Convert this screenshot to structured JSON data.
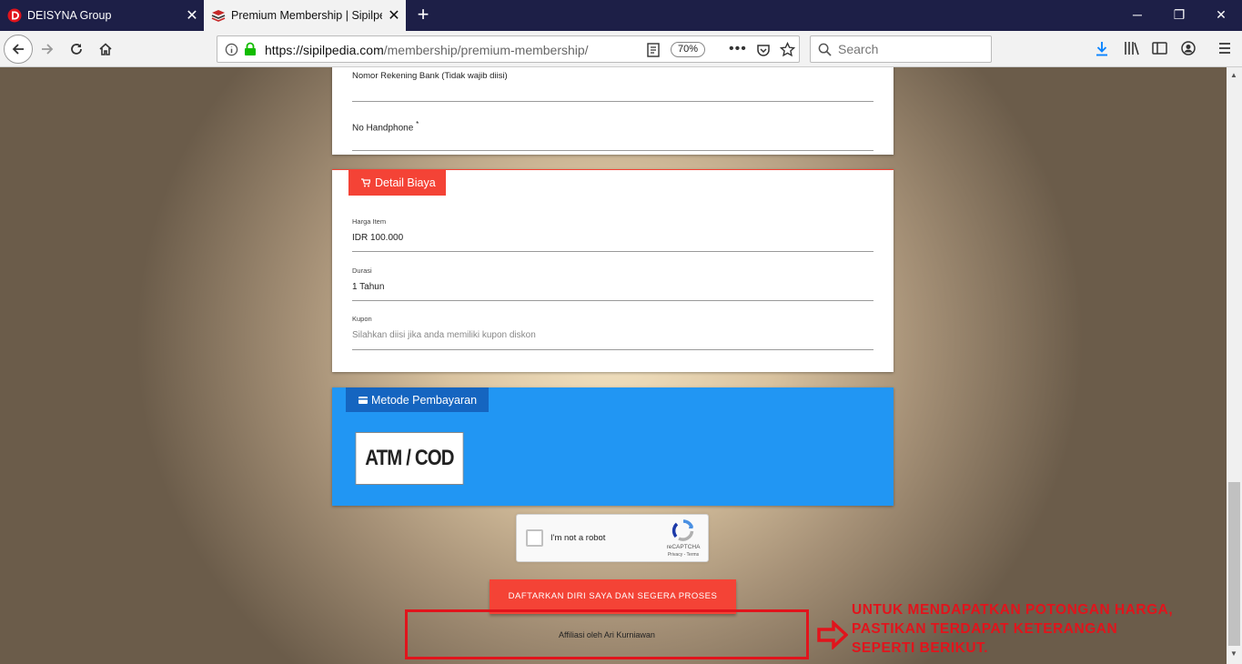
{
  "browser": {
    "tabs": [
      {
        "title": "DEISYNA Group",
        "active": false
      },
      {
        "title": "Premium Membership | Sipilpe",
        "active": true
      }
    ],
    "url_domain": "https://sipilpedia.com",
    "url_path": "/membership/premium-membership/",
    "zoom": "70%",
    "search_placeholder": "Search",
    "accent": "#1d1f47"
  },
  "form": {
    "rekening_label": "Nomor Rekening Bank (Tidak wajib diisi)",
    "hp_label": "No Handphone",
    "hp_required": "*"
  },
  "detail_biaya": {
    "title": "Detail Biaya",
    "color": "#f44336",
    "fields": [
      {
        "label": "Harga Item",
        "value": "IDR 100.000"
      },
      {
        "label": "Durasi",
        "value": "1 Tahun"
      },
      {
        "label": "Kupon",
        "placeholder": "Silahkan diisi jika anda memiliki kupon diskon"
      }
    ]
  },
  "payment": {
    "title": "Metode Pembayaran",
    "color": "#2196f3",
    "option": "ATM / COD"
  },
  "captcha": {
    "label": "I'm not a robot",
    "brand": "reCAPTCHA",
    "terms": "Privacy - Terms"
  },
  "submit_label": "DAFTARKAN DIRI SAYA DAN SEGERA PROSES",
  "affiliate": "Affiliasi oleh Ari Kurniawan",
  "annotation": {
    "lines": [
      "UNTUK MENDAPATKAN POTONGAN HARGA,",
      "PASTIKAN TERDAPAT KETERANGAN",
      "SEPERTI BERIKUT."
    ],
    "color": "#e1141c"
  }
}
